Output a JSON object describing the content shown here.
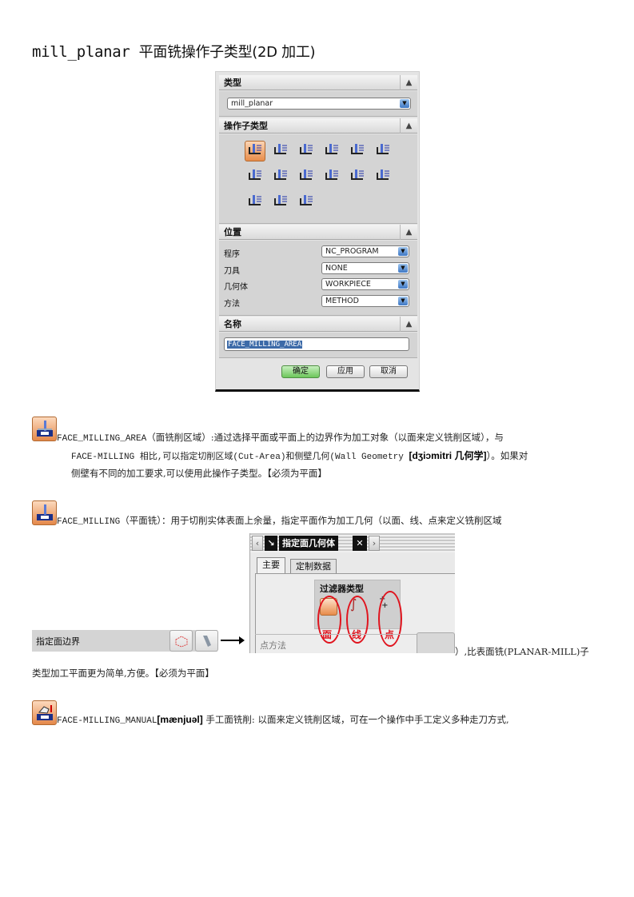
{
  "title": {
    "code": "mill_planar",
    "rest": "平面铣操作子类型(2D 加工)"
  },
  "dialog": {
    "type_section": {
      "header": "类型",
      "value": "mill_planar"
    },
    "subtype_section": {
      "header": "操作子类型",
      "operations": [
        "face-milling-area-icon",
        "face-milling-icon",
        "face-milling-manual-icon",
        "planar-mill-icon",
        "planar-profile-icon",
        "rough-follow-icon",
        "rough-zigzag-icon",
        "rough-zig-icon",
        "cleanup-corners-icon",
        "finish-walls-icon",
        "finish-floor-icon",
        "thread-milling-icon",
        "planar-text-icon",
        "mill-control-icon",
        "mill-user-icon"
      ],
      "selected_index": 0
    },
    "location_section": {
      "header": "位置",
      "rows": [
        {
          "label": "程序",
          "value": "NC_PROGRAM"
        },
        {
          "label": "刀具",
          "value": "NONE"
        },
        {
          "label": "几何体",
          "value": "WORKPIECE"
        },
        {
          "label": "方法",
          "value": "METHOD"
        }
      ]
    },
    "name_section": {
      "header": "名称",
      "value": "FACE_MILLING_AREA"
    },
    "buttons": {
      "ok": "确定",
      "apply": "应用",
      "cancel": "取消"
    }
  },
  "paragraphs": {
    "p1": {
      "line1_code": "FACE_MILLING_AREA",
      "line1_rest": "（面铣削区域）:通过选择平面或平面上的边界作为加工对象（以面来定义铣削区域），与",
      "line2_a": "FACE-MILLING 相比,可以指定切削区域(Cut-Area)和侧壁几何(Wall Geometry ",
      "line2_phonetic": "[dʒiɔmitri 几何学]",
      "line2_b": "）。如果对",
      "line3": "侧壁有不同的加工要求,可以使用此操作子类型。【必须为平面】"
    },
    "p2": {
      "line1_code": "FACE_MILLING",
      "line1_rest": "（平面铣）：用于切削实体表面上余量，指定平面作为加工几何（以面、线、点来定义铣削区域",
      "line2_tail": "）,比表面铣(PLANAR-MILL)子",
      "line3": "类型加工平面更为简单,方便。【必须为平面】"
    },
    "p3": {
      "code": "FACE-MILLING_MANUAL",
      "phonetic": "[mænjuəl]",
      "rest": " 手工面铣削: 以面来定义铣削区域，可在一个操作中手工定义多种走刀方式,"
    }
  },
  "face_geometry_dialog": {
    "title": "指定面几何体",
    "tabs": [
      "主要",
      "定制数据"
    ],
    "filter_title": "过滤器类型",
    "annotations": [
      "面",
      "线",
      "点"
    ],
    "point_method_label": "点方法"
  },
  "boundary_row": {
    "label": "指定面边界"
  },
  "colors": {
    "selected_op": "#e88c4a",
    "annotation_red": "#e0141e",
    "ok_green": "#6cc65a",
    "combo_arrow": "#3f78c4"
  }
}
